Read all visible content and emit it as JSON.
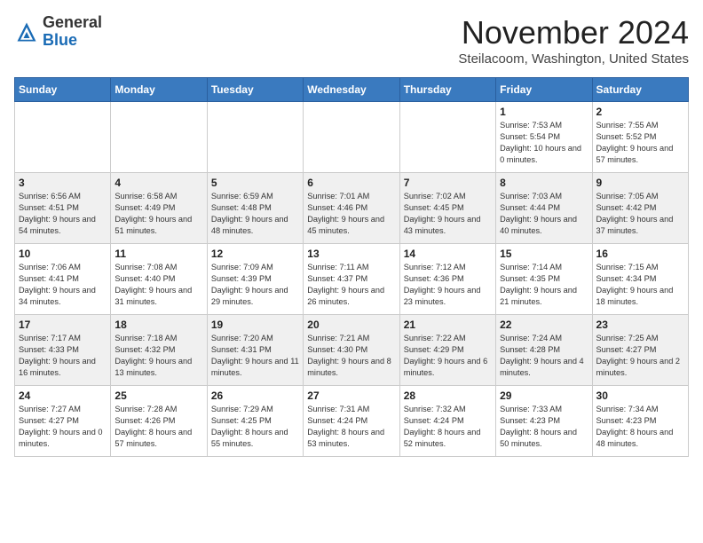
{
  "header": {
    "logo_general": "General",
    "logo_blue": "Blue",
    "month": "November 2024",
    "location": "Steilacoom, Washington, United States"
  },
  "calendar": {
    "weekdays": [
      "Sunday",
      "Monday",
      "Tuesday",
      "Wednesday",
      "Thursday",
      "Friday",
      "Saturday"
    ],
    "weeks": [
      [
        {
          "day": "",
          "sunrise": "",
          "sunset": "",
          "daylight": ""
        },
        {
          "day": "",
          "sunrise": "",
          "sunset": "",
          "daylight": ""
        },
        {
          "day": "",
          "sunrise": "",
          "sunset": "",
          "daylight": ""
        },
        {
          "day": "",
          "sunrise": "",
          "sunset": "",
          "daylight": ""
        },
        {
          "day": "",
          "sunrise": "",
          "sunset": "",
          "daylight": ""
        },
        {
          "day": "1",
          "sunrise": "Sunrise: 7:53 AM",
          "sunset": "Sunset: 5:54 PM",
          "daylight": "Daylight: 10 hours and 0 minutes."
        },
        {
          "day": "2",
          "sunrise": "Sunrise: 7:55 AM",
          "sunset": "Sunset: 5:52 PM",
          "daylight": "Daylight: 9 hours and 57 minutes."
        }
      ],
      [
        {
          "day": "3",
          "sunrise": "Sunrise: 6:56 AM",
          "sunset": "Sunset: 4:51 PM",
          "daylight": "Daylight: 9 hours and 54 minutes."
        },
        {
          "day": "4",
          "sunrise": "Sunrise: 6:58 AM",
          "sunset": "Sunset: 4:49 PM",
          "daylight": "Daylight: 9 hours and 51 minutes."
        },
        {
          "day": "5",
          "sunrise": "Sunrise: 6:59 AM",
          "sunset": "Sunset: 4:48 PM",
          "daylight": "Daylight: 9 hours and 48 minutes."
        },
        {
          "day": "6",
          "sunrise": "Sunrise: 7:01 AM",
          "sunset": "Sunset: 4:46 PM",
          "daylight": "Daylight: 9 hours and 45 minutes."
        },
        {
          "day": "7",
          "sunrise": "Sunrise: 7:02 AM",
          "sunset": "Sunset: 4:45 PM",
          "daylight": "Daylight: 9 hours and 43 minutes."
        },
        {
          "day": "8",
          "sunrise": "Sunrise: 7:03 AM",
          "sunset": "Sunset: 4:44 PM",
          "daylight": "Daylight: 9 hours and 40 minutes."
        },
        {
          "day": "9",
          "sunrise": "Sunrise: 7:05 AM",
          "sunset": "Sunset: 4:42 PM",
          "daylight": "Daylight: 9 hours and 37 minutes."
        }
      ],
      [
        {
          "day": "10",
          "sunrise": "Sunrise: 7:06 AM",
          "sunset": "Sunset: 4:41 PM",
          "daylight": "Daylight: 9 hours and 34 minutes."
        },
        {
          "day": "11",
          "sunrise": "Sunrise: 7:08 AM",
          "sunset": "Sunset: 4:40 PM",
          "daylight": "Daylight: 9 hours and 31 minutes."
        },
        {
          "day": "12",
          "sunrise": "Sunrise: 7:09 AM",
          "sunset": "Sunset: 4:39 PM",
          "daylight": "Daylight: 9 hours and 29 minutes."
        },
        {
          "day": "13",
          "sunrise": "Sunrise: 7:11 AM",
          "sunset": "Sunset: 4:37 PM",
          "daylight": "Daylight: 9 hours and 26 minutes."
        },
        {
          "day": "14",
          "sunrise": "Sunrise: 7:12 AM",
          "sunset": "Sunset: 4:36 PM",
          "daylight": "Daylight: 9 hours and 23 minutes."
        },
        {
          "day": "15",
          "sunrise": "Sunrise: 7:14 AM",
          "sunset": "Sunset: 4:35 PM",
          "daylight": "Daylight: 9 hours and 21 minutes."
        },
        {
          "day": "16",
          "sunrise": "Sunrise: 7:15 AM",
          "sunset": "Sunset: 4:34 PM",
          "daylight": "Daylight: 9 hours and 18 minutes."
        }
      ],
      [
        {
          "day": "17",
          "sunrise": "Sunrise: 7:17 AM",
          "sunset": "Sunset: 4:33 PM",
          "daylight": "Daylight: 9 hours and 16 minutes."
        },
        {
          "day": "18",
          "sunrise": "Sunrise: 7:18 AM",
          "sunset": "Sunset: 4:32 PM",
          "daylight": "Daylight: 9 hours and 13 minutes."
        },
        {
          "day": "19",
          "sunrise": "Sunrise: 7:20 AM",
          "sunset": "Sunset: 4:31 PM",
          "daylight": "Daylight: 9 hours and 11 minutes."
        },
        {
          "day": "20",
          "sunrise": "Sunrise: 7:21 AM",
          "sunset": "Sunset: 4:30 PM",
          "daylight": "Daylight: 9 hours and 8 minutes."
        },
        {
          "day": "21",
          "sunrise": "Sunrise: 7:22 AM",
          "sunset": "Sunset: 4:29 PM",
          "daylight": "Daylight: 9 hours and 6 minutes."
        },
        {
          "day": "22",
          "sunrise": "Sunrise: 7:24 AM",
          "sunset": "Sunset: 4:28 PM",
          "daylight": "Daylight: 9 hours and 4 minutes."
        },
        {
          "day": "23",
          "sunrise": "Sunrise: 7:25 AM",
          "sunset": "Sunset: 4:27 PM",
          "daylight": "Daylight: 9 hours and 2 minutes."
        }
      ],
      [
        {
          "day": "24",
          "sunrise": "Sunrise: 7:27 AM",
          "sunset": "Sunset: 4:27 PM",
          "daylight": "Daylight: 9 hours and 0 minutes."
        },
        {
          "day": "25",
          "sunrise": "Sunrise: 7:28 AM",
          "sunset": "Sunset: 4:26 PM",
          "daylight": "Daylight: 8 hours and 57 minutes."
        },
        {
          "day": "26",
          "sunrise": "Sunrise: 7:29 AM",
          "sunset": "Sunset: 4:25 PM",
          "daylight": "Daylight: 8 hours and 55 minutes."
        },
        {
          "day": "27",
          "sunrise": "Sunrise: 7:31 AM",
          "sunset": "Sunset: 4:24 PM",
          "daylight": "Daylight: 8 hours and 53 minutes."
        },
        {
          "day": "28",
          "sunrise": "Sunrise: 7:32 AM",
          "sunset": "Sunset: 4:24 PM",
          "daylight": "Daylight: 8 hours and 52 minutes."
        },
        {
          "day": "29",
          "sunrise": "Sunrise: 7:33 AM",
          "sunset": "Sunset: 4:23 PM",
          "daylight": "Daylight: 8 hours and 50 minutes."
        },
        {
          "day": "30",
          "sunrise": "Sunrise: 7:34 AM",
          "sunset": "Sunset: 4:23 PM",
          "daylight": "Daylight: 8 hours and 48 minutes."
        }
      ]
    ]
  }
}
